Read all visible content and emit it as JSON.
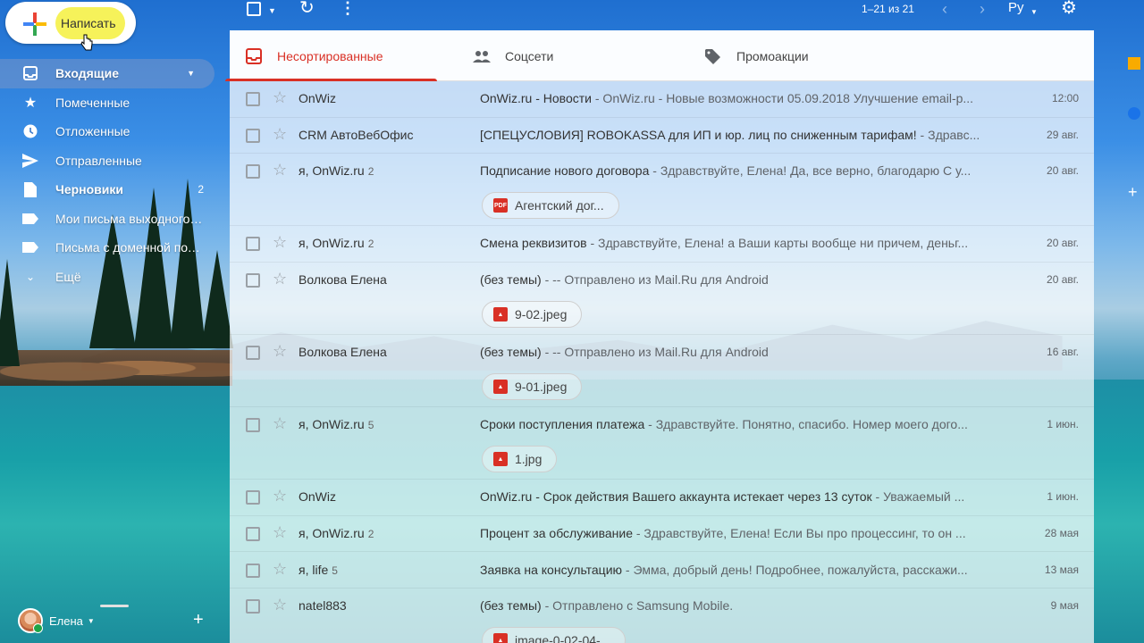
{
  "compose": {
    "label": "Написать"
  },
  "toolbar": {
    "pagination": "1–21 из 21",
    "lang": "Ру"
  },
  "nav": [
    {
      "label": "Входящие",
      "icon": "inbox-icon",
      "active": true
    },
    {
      "label": "Помеченные",
      "icon": "star-icon"
    },
    {
      "label": "Отложенные",
      "icon": "clock-icon"
    },
    {
      "label": "Отправленные",
      "icon": "send-icon"
    },
    {
      "label": "Черновики",
      "icon": "draft-icon",
      "count": "2",
      "bold": true
    },
    {
      "label": "Мои письма выходного дня",
      "icon": "label-icon"
    },
    {
      "label": "Письма с доменной почты",
      "icon": "label-icon"
    },
    {
      "label": "Ещё",
      "icon": "chevron-down-icon"
    }
  ],
  "user": {
    "name": "Елена"
  },
  "tabs": [
    {
      "label": "Несортированные",
      "icon": "inbox-tab-icon",
      "active": true
    },
    {
      "label": "Соцсети",
      "icon": "people-icon"
    },
    {
      "label": "Промоакции",
      "icon": "tag-icon"
    }
  ],
  "emails": [
    {
      "sender": "OnWiz",
      "count": "",
      "subject": "OnWiz.ru - Новости",
      "snippet": " - OnWiz.ru - Новые возможности 05.09.2018 Улучшение email-р...",
      "date": "12:00"
    },
    {
      "sender": "CRM АвтоВебОфис",
      "count": "",
      "subject": "[СПЕЦУСЛОВИЯ] ROBOKASSA для ИП и юр. лиц по сниженным тарифам!",
      "snippet": " - Здравс...",
      "date": "29 авг."
    },
    {
      "sender": "я, OnWiz.ru",
      "count": "2",
      "subject": "Подписание нового договора",
      "snippet": " - Здравствуйте, Елена! Да, все верно, благодарю С у...",
      "date": "20 авг.",
      "attachment": "Агентский дог...",
      "att_type": "PDF"
    },
    {
      "sender": "я, OnWiz.ru",
      "count": "2",
      "subject": "Смена реквизитов",
      "snippet": " - Здравствуйте, Елена! а Ваши карты вообще ни причем, деньг...",
      "date": "20 авг."
    },
    {
      "sender": "Волкова Елена",
      "count": "",
      "subject": "(без темы)",
      "snippet": " - -- Отправлено из Mail.Ru для Android",
      "date": "20 авг.",
      "attachment": "9-02.jpeg",
      "att_type": "img"
    },
    {
      "sender": "Волкова Елена",
      "count": "",
      "subject": "(без темы)",
      "snippet": " - -- Отправлено из Mail.Ru для Android",
      "date": "16 авг.",
      "attachment": "9-01.jpeg",
      "att_type": "img"
    },
    {
      "sender": "я, OnWiz.ru",
      "count": "5",
      "subject": "Сроки поступления платежа",
      "snippet": " - Здравствуйте. Понятно, спасибо. Номер моего дого...",
      "date": "1 июн.",
      "attachment": "1.jpg",
      "att_type": "img"
    },
    {
      "sender": "OnWiz",
      "count": "",
      "subject": "OnWiz.ru - Срок действия Вашего аккаунта истекает через 13 суток",
      "snippet": " - Уважаемый ...",
      "date": "1 июн."
    },
    {
      "sender": "я, OnWiz.ru",
      "count": "2",
      "subject": "Процент за обслуживание",
      "snippet": " - Здравствуйте, Елена! Если Вы про процессинг, то он ...",
      "date": "28 мая"
    },
    {
      "sender": "я, life",
      "count": "5",
      "subject": "Заявка на консультацию",
      "snippet": " - Эмма, добрый день! Подробнее, пожалуйста, расскажи...",
      "date": "13 мая"
    },
    {
      "sender": "natel883",
      "count": "",
      "subject": "(без темы)",
      "snippet": " - Отправлено с Samsung Mobile.",
      "date": "9 мая",
      "attachment": "image-0-02-04-...",
      "att_type": "img"
    }
  ]
}
